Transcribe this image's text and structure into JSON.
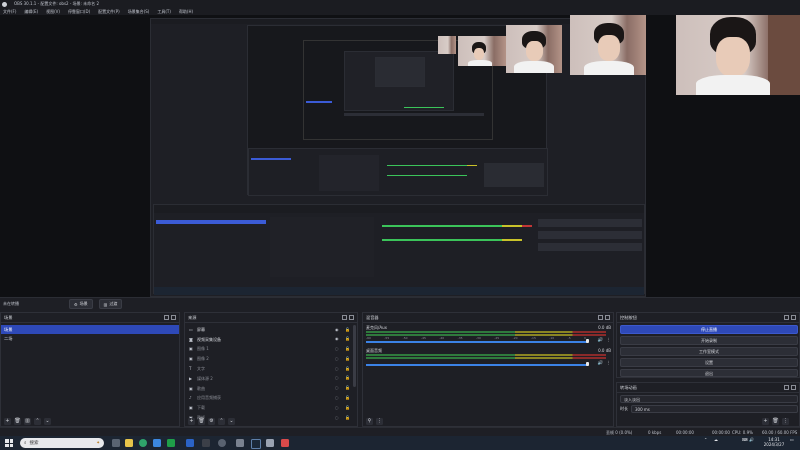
{
  "window": {
    "title": "OBS 30.1.1 - 配置文件: obs2 - 场景: 未命名 2"
  },
  "menu": [
    "文件(F)",
    "编辑(E)",
    "视图(V)",
    "停靠窗口(D)",
    "配置文件(P)",
    "场景集合(S)",
    "工具(T)",
    "帮助(H)"
  ],
  "modebar": {
    "label": "未在转播",
    "scene_btn": "场景",
    "transition_btn": "过渡"
  },
  "scenes": {
    "title": "场景",
    "items": [
      {
        "label": "场景",
        "selected": true
      },
      {
        "label": "二场",
        "selected": false
      }
    ]
  },
  "sources": {
    "title": "来源",
    "items": [
      {
        "label": "屏幕",
        "icon": "monitor-icon",
        "visible": true
      },
      {
        "label": "视频采集设备",
        "icon": "camera-icon",
        "visible": true
      },
      {
        "label": "图像 1",
        "icon": "image-icon",
        "visible": false
      },
      {
        "label": "图像 2",
        "icon": "image-icon",
        "visible": false
      },
      {
        "label": "文字",
        "icon": "text-icon",
        "visible": false
      },
      {
        "label": "媒体源 2",
        "icon": "play-icon",
        "visible": false
      },
      {
        "label": "歌曲",
        "icon": "image-icon",
        "visible": false
      },
      {
        "label": "应用音频捕获",
        "icon": "audio-icon",
        "visible": false
      },
      {
        "label": "下载",
        "icon": "image-icon",
        "visible": false
      },
      {
        "label": "静帧",
        "icon": "image-icon",
        "visible": false
      }
    ]
  },
  "mixer": {
    "title": "混音器",
    "channels": [
      {
        "name": "麦克风/Aux",
        "db": "0.0 dB",
        "fader": 0.92
      },
      {
        "name": "桌面音频",
        "db": "0.0 dB",
        "fader": 0.92
      }
    ],
    "ticks": [
      "-60",
      "-55",
      "-50",
      "-45",
      "-40",
      "-35",
      "-30",
      "-25",
      "-20",
      "-15",
      "-10",
      "-5",
      "0"
    ]
  },
  "controls": {
    "title": "控制按钮",
    "buttons": [
      "停止直播",
      "开始录制",
      "工作室模式",
      "设置",
      "退出"
    ]
  },
  "transitions": {
    "title": "转场动画",
    "type": "淡入淡出",
    "duration_label": "时长",
    "duration_value": "300 ms"
  },
  "status": {
    "frames": "丢帧 0 (0.0%)",
    "bitrate": "0 kbps",
    "time1": "00:00:00",
    "time2": "00:00:00",
    "cpu": "CPU: 0.9%",
    "fps": "60.00 / 60.00 FPS"
  },
  "taskbar": {
    "search": "搜索",
    "time": "14:31",
    "date": "2024/3/27"
  },
  "colors": {
    "accent": "#2e49b8",
    "meter_green": "#3bc45a",
    "meter_yellow": "#c9c22a",
    "meter_red": "#c23636",
    "fader_blue": "#3b82e6"
  }
}
